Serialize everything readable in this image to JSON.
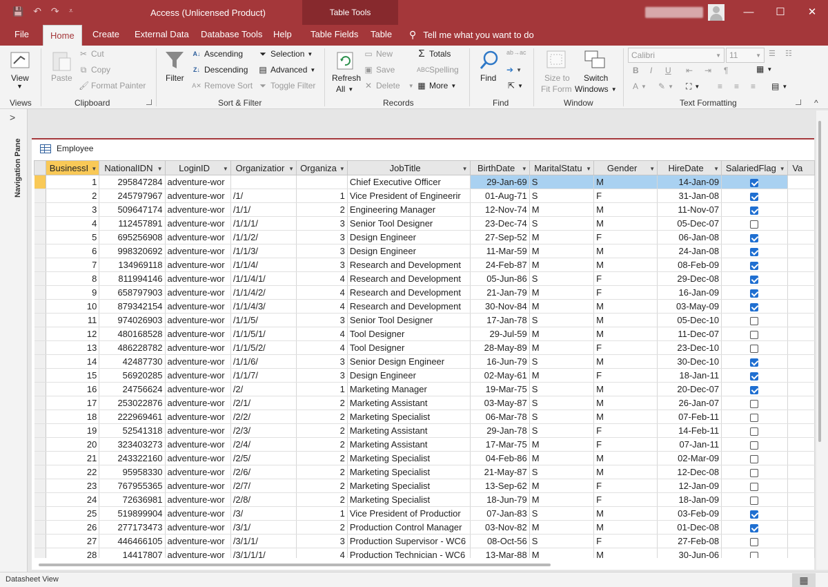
{
  "window": {
    "title": "Access (Unlicensed Product)",
    "contextual_tab_group": "Table Tools",
    "controls": {
      "minimize": "—",
      "maximize": "☐",
      "close": "✕"
    }
  },
  "quick_access": {
    "save": "💾",
    "undo": "↶",
    "redo": "↷",
    "customize": "⩡"
  },
  "ribbon_tabs": [
    "File",
    "Home",
    "Create",
    "External Data",
    "Database Tools",
    "Help",
    "Table Fields",
    "Table"
  ],
  "active_tab": "Home",
  "tell_me": "Tell me what you want to do",
  "ribbon": {
    "views": {
      "view": "View",
      "group": "Views"
    },
    "clipboard": {
      "paste": "Paste",
      "cut": "Cut",
      "copy": "Copy",
      "format_painter": "Format Painter",
      "group": "Clipboard"
    },
    "sort_filter": {
      "filter": "Filter",
      "ascending": "Ascending",
      "descending": "Descending",
      "remove_sort": "Remove Sort",
      "selection": "Selection",
      "advanced": "Advanced",
      "toggle_filter": "Toggle Filter",
      "group": "Sort & Filter"
    },
    "records": {
      "refresh_line1": "Refresh",
      "refresh_line2": "All",
      "new": "New",
      "save": "Save",
      "delete": "Delete",
      "totals": "Totals",
      "spelling": "Spelling",
      "more": "More",
      "group": "Records"
    },
    "find": {
      "find": "Find",
      "group": "Find"
    },
    "window": {
      "size_line1": "Size to",
      "size_line2": "Fit Form",
      "switch_line1": "Switch",
      "switch_line2": "Windows",
      "group": "Window"
    },
    "text_formatting": {
      "font": "Calibri",
      "size": "11",
      "bold": "B",
      "italic": "I",
      "underline": "U",
      "group": "Text Formatting"
    }
  },
  "nav_pane": {
    "label": "Navigation Pane"
  },
  "document": {
    "tab_label": "Employee"
  },
  "grid": {
    "columns": [
      "BusinessI",
      "NationalIDN",
      "LoginID",
      "Organizatior",
      "Organiza",
      "JobTitle",
      "BirthDate",
      "MaritalStatu",
      "Gender",
      "HireDate",
      "SalariedFlag",
      "Va"
    ],
    "rows": [
      [
        "1",
        "295847284",
        "adventure-wor",
        "",
        "",
        "Chief Executive Officer",
        "29-Jan-69",
        "S",
        "M",
        "14-Jan-09",
        true
      ],
      [
        "2",
        "245797967",
        "adventure-wor",
        "/1/",
        "1",
        "Vice President of Engineerir",
        "01-Aug-71",
        "S",
        "F",
        "31-Jan-08",
        true
      ],
      [
        "3",
        "509647174",
        "adventure-wor",
        "/1/1/",
        "2",
        "Engineering Manager",
        "12-Nov-74",
        "M",
        "M",
        "11-Nov-07",
        true
      ],
      [
        "4",
        "112457891",
        "adventure-wor",
        "/1/1/1/",
        "3",
        "Senior Tool Designer",
        "23-Dec-74",
        "S",
        "M",
        "05-Dec-07",
        false
      ],
      [
        "5",
        "695256908",
        "adventure-wor",
        "/1/1/2/",
        "3",
        "Design Engineer",
        "27-Sep-52",
        "M",
        "F",
        "06-Jan-08",
        true
      ],
      [
        "6",
        "998320692",
        "adventure-wor",
        "/1/1/3/",
        "3",
        "Design Engineer",
        "11-Mar-59",
        "M",
        "M",
        "24-Jan-08",
        true
      ],
      [
        "7",
        "134969118",
        "adventure-wor",
        "/1/1/4/",
        "3",
        "Research and Development",
        "24-Feb-87",
        "M",
        "M",
        "08-Feb-09",
        true
      ],
      [
        "8",
        "811994146",
        "adventure-wor",
        "/1/1/4/1/",
        "4",
        "Research and Development",
        "05-Jun-86",
        "S",
        "F",
        "29-Dec-08",
        true
      ],
      [
        "9",
        "658797903",
        "adventure-wor",
        "/1/1/4/2/",
        "4",
        "Research and Development",
        "21-Jan-79",
        "M",
        "F",
        "16-Jan-09",
        true
      ],
      [
        "10",
        "879342154",
        "adventure-wor",
        "/1/1/4/3/",
        "4",
        "Research and Development",
        "30-Nov-84",
        "M",
        "M",
        "03-May-09",
        true
      ],
      [
        "11",
        "974026903",
        "adventure-wor",
        "/1/1/5/",
        "3",
        "Senior Tool Designer",
        "17-Jan-78",
        "S",
        "M",
        "05-Dec-10",
        false
      ],
      [
        "12",
        "480168528",
        "adventure-wor",
        "/1/1/5/1/",
        "4",
        "Tool Designer",
        "29-Jul-59",
        "M",
        "M",
        "11-Dec-07",
        false
      ],
      [
        "13",
        "486228782",
        "adventure-wor",
        "/1/1/5/2/",
        "4",
        "Tool Designer",
        "28-May-89",
        "M",
        "F",
        "23-Dec-10",
        false
      ],
      [
        "14",
        "42487730",
        "adventure-wor",
        "/1/1/6/",
        "3",
        "Senior Design Engineer",
        "16-Jun-79",
        "S",
        "M",
        "30-Dec-10",
        true
      ],
      [
        "15",
        "56920285",
        "adventure-wor",
        "/1/1/7/",
        "3",
        "Design Engineer",
        "02-May-61",
        "M",
        "F",
        "18-Jan-11",
        true
      ],
      [
        "16",
        "24756624",
        "adventure-wor",
        "/2/",
        "1",
        "Marketing Manager",
        "19-Mar-75",
        "S",
        "M",
        "20-Dec-07",
        true
      ],
      [
        "17",
        "253022876",
        "adventure-wor",
        "/2/1/",
        "2",
        "Marketing Assistant",
        "03-May-87",
        "S",
        "M",
        "26-Jan-07",
        false
      ],
      [
        "18",
        "222969461",
        "adventure-wor",
        "/2/2/",
        "2",
        "Marketing Specialist",
        "06-Mar-78",
        "S",
        "M",
        "07-Feb-11",
        false
      ],
      [
        "19",
        "52541318",
        "adventure-wor",
        "/2/3/",
        "2",
        "Marketing Assistant",
        "29-Jan-78",
        "S",
        "F",
        "14-Feb-11",
        false
      ],
      [
        "20",
        "323403273",
        "adventure-wor",
        "/2/4/",
        "2",
        "Marketing Assistant",
        "17-Mar-75",
        "M",
        "F",
        "07-Jan-11",
        false
      ],
      [
        "21",
        "243322160",
        "adventure-wor",
        "/2/5/",
        "2",
        "Marketing Specialist",
        "04-Feb-86",
        "M",
        "M",
        "02-Mar-09",
        false
      ],
      [
        "22",
        "95958330",
        "adventure-wor",
        "/2/6/",
        "2",
        "Marketing Specialist",
        "21-May-87",
        "S",
        "M",
        "12-Dec-08",
        false
      ],
      [
        "23",
        "767955365",
        "adventure-wor",
        "/2/7/",
        "2",
        "Marketing Specialist",
        "13-Sep-62",
        "M",
        "F",
        "12-Jan-09",
        false
      ],
      [
        "24",
        "72636981",
        "adventure-wor",
        "/2/8/",
        "2",
        "Marketing Specialist",
        "18-Jun-79",
        "M",
        "F",
        "18-Jan-09",
        false
      ],
      [
        "25",
        "519899904",
        "adventure-wor",
        "/3/",
        "1",
        "Vice President of Productior",
        "07-Jan-83",
        "S",
        "M",
        "03-Feb-09",
        true
      ],
      [
        "26",
        "277173473",
        "adventure-wor",
        "/3/1/",
        "2",
        "Production Control Manager",
        "03-Nov-82",
        "M",
        "M",
        "01-Dec-08",
        true
      ],
      [
        "27",
        "446466105",
        "adventure-wor",
        "/3/1/1/",
        "3",
        "Production Supervisor - WC6",
        "08-Oct-56",
        "S",
        "F",
        "27-Feb-08",
        false
      ],
      [
        "28",
        "14417807",
        "adventure-wor",
        "/3/1/1/1/",
        "4",
        "Production Technician - WC6",
        "13-Mar-88",
        "M",
        "M",
        "30-Jun-06",
        false
      ]
    ]
  },
  "status_bar": {
    "view": "Datasheet View"
  },
  "colors": {
    "brand": "#a4373a",
    "selected_header": "#f9c957",
    "selected_row": "#a9d1f1"
  }
}
